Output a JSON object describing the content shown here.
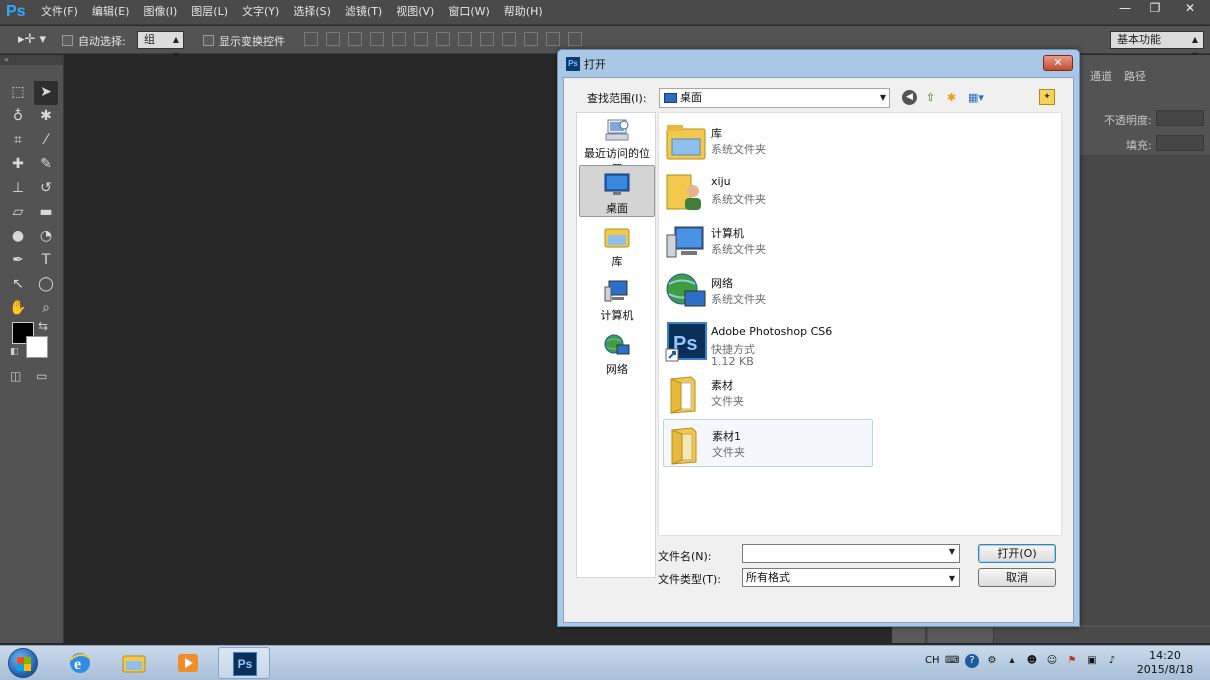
{
  "app": {
    "logo": "Ps",
    "menu": [
      "文件(F)",
      "编辑(E)",
      "图像(I)",
      "图层(L)",
      "文字(Y)",
      "选择(S)",
      "滤镜(T)",
      "视图(V)",
      "窗口(W)",
      "帮助(H)"
    ],
    "window_controls": {
      "minimize": "—",
      "restore": "❐",
      "close": "✕"
    }
  },
  "options_bar": {
    "auto_select_label": "自动选择:",
    "auto_select_value": "组",
    "show_transform_label": "显示变换控件",
    "workspace": "基本功能"
  },
  "right_panel": {
    "tabs": [
      "通道",
      "路径"
    ],
    "opacity_label": "不透明度:",
    "fill_label": "填充:"
  },
  "dialog": {
    "title": "打开",
    "title_icon": "Ps",
    "look_in_label": "查找范围(I):",
    "look_in_value": "桌面",
    "places": [
      {
        "label": "最近访问的位置",
        "icon": "recent-places-icon"
      },
      {
        "label": "桌面",
        "icon": "desktop-icon",
        "selected": true
      },
      {
        "label": "库",
        "icon": "library-icon"
      },
      {
        "label": "计算机",
        "icon": "computer-icon"
      },
      {
        "label": "网络",
        "icon": "network-icon"
      }
    ],
    "files": [
      {
        "name": "库",
        "type": "系统文件夹",
        "icon": "library-icon"
      },
      {
        "name": "xiju",
        "type": "系统文件夹",
        "icon": "user-folder-icon"
      },
      {
        "name": "计算机",
        "type": "系统文件夹",
        "icon": "computer-icon"
      },
      {
        "name": "网络",
        "type": "系统文件夹",
        "icon": "network-icon"
      },
      {
        "name": "Adobe Photoshop CS6",
        "type": "快捷方式",
        "size": "1.12 KB",
        "icon": "photoshop-shortcut-icon"
      },
      {
        "name": "素材",
        "type": "文件夹",
        "icon": "folder-icon"
      },
      {
        "name": "素材1",
        "type": "文件夹",
        "icon": "folder-icon",
        "highlighted": true
      }
    ],
    "filename_label": "文件名(N):",
    "filename_value": "",
    "filetype_label": "文件类型(T):",
    "filetype_value": "所有格式",
    "open_button": "打开(O)",
    "cancel_button": "取消"
  },
  "taskbar": {
    "apps": [
      "internet-explorer-icon",
      "explorer-icon",
      "media-player-icon",
      "photoshop-icon"
    ],
    "active_app_label": "Ps",
    "tray_lang": "CH",
    "time": "14:20",
    "date": "2015/8/18"
  }
}
